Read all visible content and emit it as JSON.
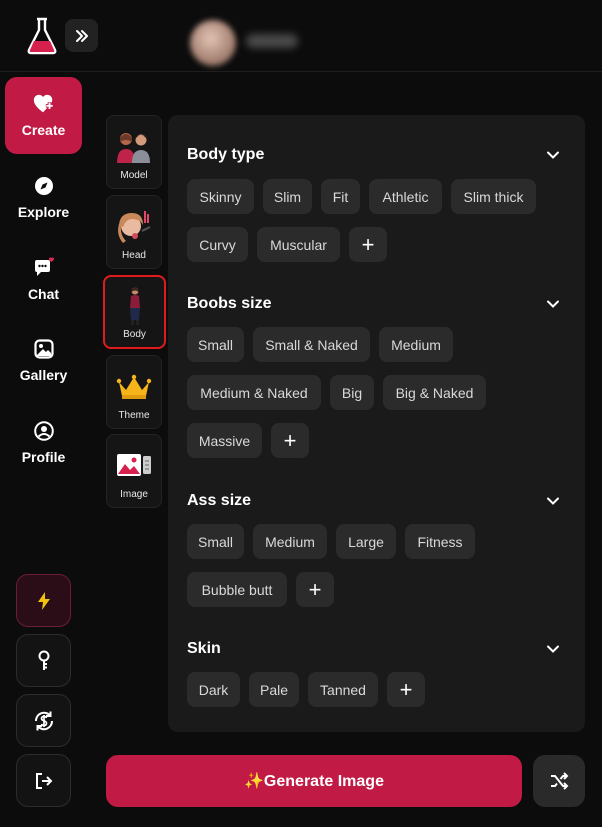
{
  "nav": {
    "items": [
      {
        "label": "Create",
        "icon": "heart-plus-icon",
        "active": true
      },
      {
        "label": "Explore",
        "icon": "compass-icon"
      },
      {
        "label": "Chat",
        "icon": "chat-icon"
      },
      {
        "label": "Gallery",
        "icon": "gallery-icon"
      },
      {
        "label": "Profile",
        "icon": "profile-icon"
      }
    ]
  },
  "categories": [
    {
      "label": "Model",
      "icon": "model-icon"
    },
    {
      "label": "Head",
      "icon": "head-icon"
    },
    {
      "label": "Body",
      "icon": "body-icon",
      "selected": true
    },
    {
      "label": "Theme",
      "icon": "crown-icon"
    },
    {
      "label": "Image",
      "icon": "image-icon"
    }
  ],
  "sections": {
    "body_type": {
      "title": "Body type",
      "options": [
        "Skinny",
        "Slim",
        "Fit",
        "Athletic",
        "Slim thick",
        "Curvy",
        "Muscular"
      ]
    },
    "boobs_size": {
      "title": "Boobs size",
      "options": [
        "Small",
        "Small & Naked",
        "Medium",
        "Medium & Naked",
        "Big",
        "Big & Naked",
        "Massive"
      ]
    },
    "ass_size": {
      "title": "Ass size",
      "options": [
        "Small",
        "Medium",
        "Large",
        "Fitness",
        "Bubble butt"
      ]
    },
    "skin": {
      "title": "Skin",
      "options": [
        "Dark",
        "Pale",
        "Tanned"
      ]
    }
  },
  "add_label": "+",
  "generate_label": "✨Generate Image",
  "colors": {
    "accent": "#c01a45",
    "panel": "#1a1a1a",
    "chip": "#2b2b2b",
    "selection_outline": "#e01b1b"
  }
}
